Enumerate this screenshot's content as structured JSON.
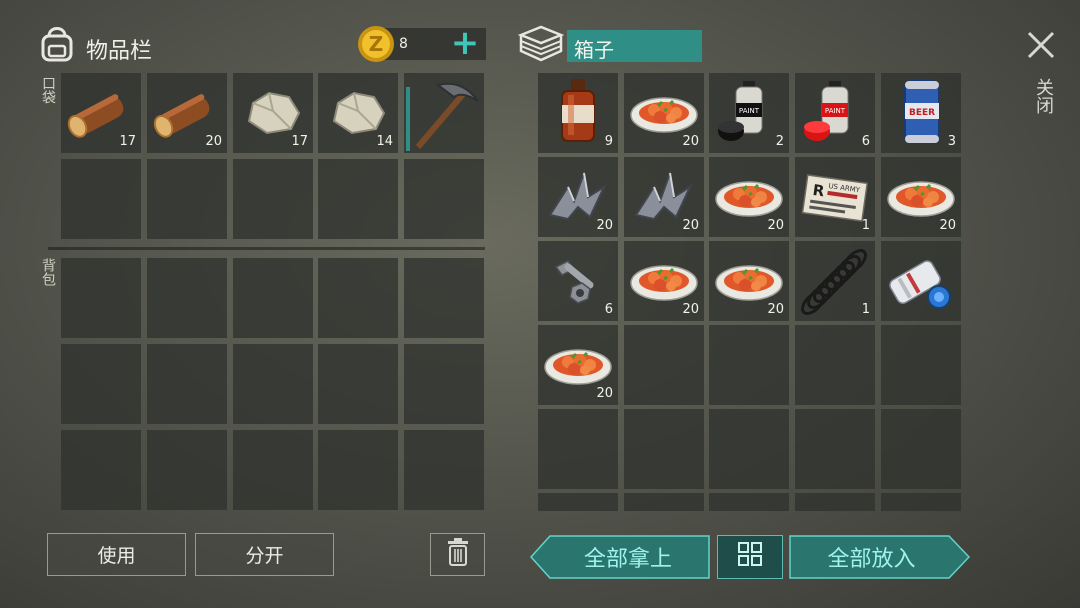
{
  "inventory": {
    "title": "物品栏",
    "pocket_label": "口袋",
    "backpack_label": "背包"
  },
  "currency": {
    "amount": "8",
    "add_label": "+"
  },
  "chest": {
    "title": "箱子",
    "close_label": "关闭"
  },
  "pocket_items": [
    {
      "icon": "log-icon",
      "count": "17"
    },
    {
      "icon": "log-icon",
      "count": "20"
    },
    {
      "icon": "stone-icon",
      "count": "17"
    },
    {
      "icon": "stone-icon",
      "count": "14"
    },
    {
      "icon": "pickaxe-icon",
      "count": ""
    }
  ],
  "chest_items": [
    {
      "icon": "medicine-bottle-icon",
      "count": "9"
    },
    {
      "icon": "food-plate-icon",
      "count": "20"
    },
    {
      "icon": "black-paint-can-icon",
      "count": "2"
    },
    {
      "icon": "red-paint-can-icon",
      "count": "6"
    },
    {
      "icon": "beer-can-icon",
      "count": "3"
    },
    {
      "icon": "scrap-metal-icon",
      "count": "20"
    },
    {
      "icon": "scrap-metal-icon",
      "count": "20"
    },
    {
      "icon": "food-plate-icon",
      "count": "20"
    },
    {
      "icon": "army-card-icon",
      "count": "1"
    },
    {
      "icon": "food-plate-icon",
      "count": "20"
    },
    {
      "icon": "bolt-nut-icon",
      "count": "6"
    },
    {
      "icon": "food-plate-icon",
      "count": "20"
    },
    {
      "icon": "food-plate-icon",
      "count": "20"
    },
    {
      "icon": "spring-icon",
      "count": "1"
    },
    {
      "icon": "newspaper-roll-icon",
      "count": ""
    },
    {
      "icon": "food-plate-icon",
      "count": "20"
    }
  ],
  "army_card_text": {
    "letter": "R",
    "line1": "US ARMY"
  },
  "paint_label": "PAINT",
  "beer_label": "BEER",
  "buttons": {
    "use": "使用",
    "split": "分开",
    "take_all": "全部拿上",
    "put_all": "全部放入"
  },
  "colors": {
    "accent_teal": "#2f8f86",
    "teal_text": "#9ff3ea",
    "slot_bg": "#30322e"
  }
}
